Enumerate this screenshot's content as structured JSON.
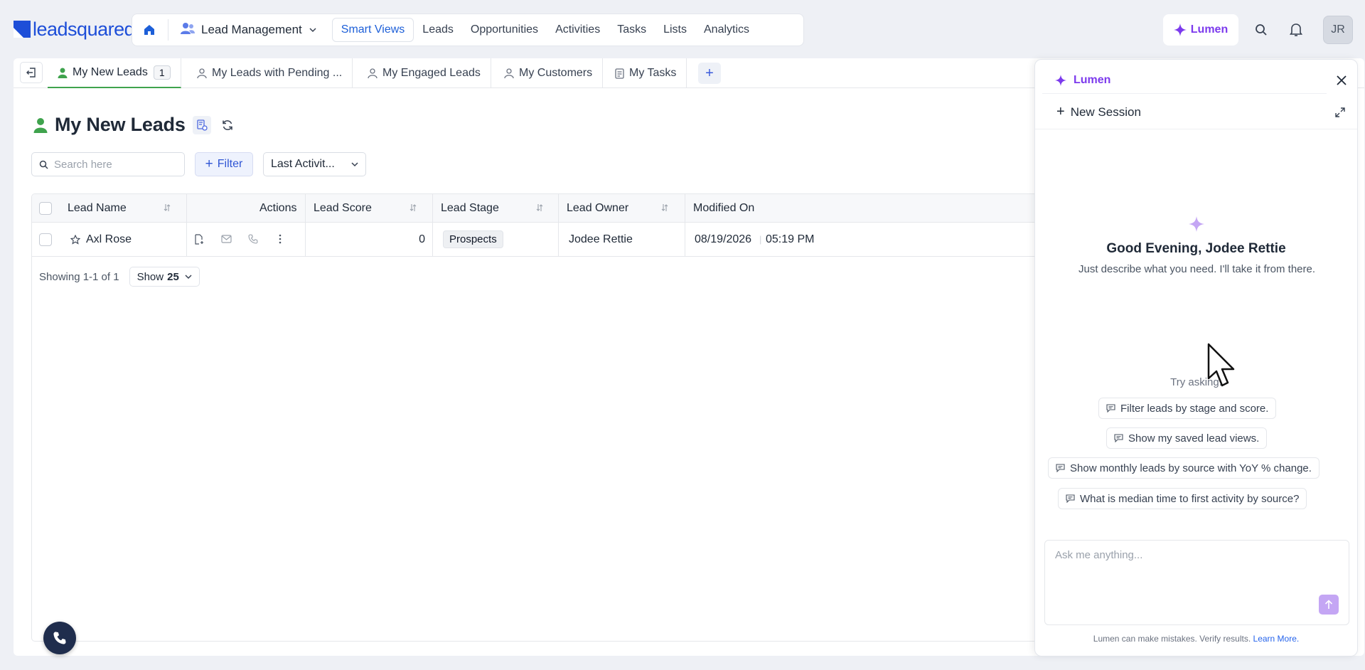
{
  "brand": {
    "logo_text": "leadsquared",
    "color": "#1d4ed8"
  },
  "nav": {
    "app_name": "Lead Management",
    "links": [
      {
        "label": "Smart Views",
        "active": true
      },
      {
        "label": "Leads"
      },
      {
        "label": "Opportunities"
      },
      {
        "label": "Activities"
      },
      {
        "label": "Tasks"
      },
      {
        "label": "Lists"
      },
      {
        "label": "Analytics"
      }
    ],
    "lumen_label": "Lumen",
    "avatar_initials": "JR"
  },
  "tabs": [
    {
      "label": "My New Leads",
      "count": "1",
      "active": true
    },
    {
      "label": "My Leads with Pending ..."
    },
    {
      "label": "My Engaged Leads"
    },
    {
      "label": "My Customers"
    },
    {
      "label": "My Tasks"
    }
  ],
  "page": {
    "title": "My New Leads",
    "search_placeholder": "Search here",
    "filter_label": "Filter",
    "sort_label": "Last Activit..."
  },
  "grid": {
    "columns": {
      "lead_name": "Lead Name",
      "actions": "Actions",
      "lead_score": "Lead Score",
      "lead_stage": "Lead Stage",
      "lead_owner": "Lead Owner",
      "modified_on": "Modified On"
    },
    "rows": [
      {
        "lead_name": "Axl Rose",
        "lead_score": "0",
        "lead_stage": "Prospects",
        "lead_owner": "Jodee Rettie",
        "modified_date": "08/19/2026",
        "modified_time": "05:19 PM"
      }
    ],
    "showing": "Showing 1-1 of 1",
    "show_label": "Show",
    "show_value": "25"
  },
  "lumen": {
    "tab_label": "Lumen",
    "new_session": "New Session",
    "greeting": "Good Evening, Jodee Rettie",
    "subtitle": "Just describe what you need. I'll take it from there.",
    "try_asking": "Try asking:",
    "suggestions": [
      "Filter leads by stage and score.",
      "Show my saved lead views.",
      "Show monthly leads by source with YoY % change.",
      "What is median time to first activity by source?"
    ],
    "input_placeholder": "Ask me anything...",
    "disclaimer": "Lumen can make mistakes. Verify results.",
    "learn_more": "Learn More.",
    "accent_color": "#7c3aed"
  }
}
